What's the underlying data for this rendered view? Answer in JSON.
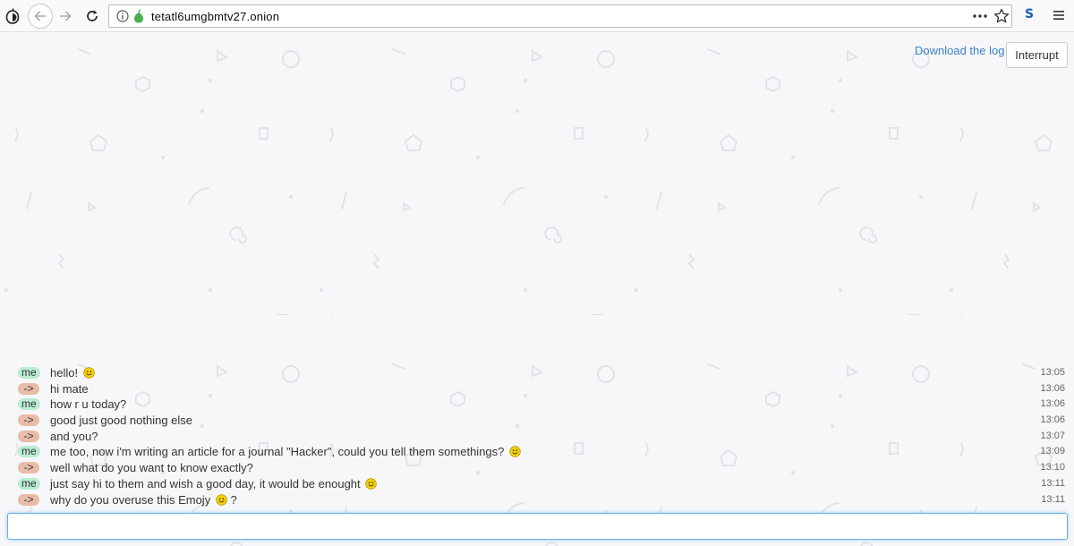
{
  "browser": {
    "url": "tetatl6umgbmtv27.onion",
    "extension_label": "S",
    "icons": [
      "tor-onion-icon",
      "back-icon",
      "forward-icon",
      "reload-icon",
      "info-icon",
      "onion-site-icon",
      "page-actions-icon",
      "bookmark-star-icon",
      "extension-s-icon",
      "hamburger-menu-icon"
    ]
  },
  "header": {
    "download_label": "Download the log",
    "interrupt_label": "Interrupt"
  },
  "messages": [
    {
      "sender": "me",
      "text": "hello!",
      "emoji": true,
      "emoji_suffix": "",
      "time": "13:05"
    },
    {
      "sender": "->",
      "text": "hi mate",
      "emoji": false,
      "emoji_suffix": "",
      "time": "13:06"
    },
    {
      "sender": "me",
      "text": "how r u today?",
      "emoji": false,
      "emoji_suffix": "",
      "time": "13:06"
    },
    {
      "sender": "->",
      "text": "good just good nothing else",
      "emoji": false,
      "emoji_suffix": "",
      "time": "13:06"
    },
    {
      "sender": "->",
      "text": "and you?",
      "emoji": false,
      "emoji_suffix": "",
      "time": "13:07"
    },
    {
      "sender": "me",
      "text": "me too, now i'm writing an article for a journal \"Hacker\", could you tell them somethings?",
      "emoji": true,
      "emoji_suffix": "",
      "time": "13:09"
    },
    {
      "sender": "->",
      "text": "well what do you want to know exactly?",
      "emoji": false,
      "emoji_suffix": "",
      "time": "13:10"
    },
    {
      "sender": "me",
      "text": "just say hi to them and wish a good day, it would be enought",
      "emoji": true,
      "emoji_suffix": "",
      "time": "13:11"
    },
    {
      "sender": "->",
      "text": "why do you overuse this Emojy",
      "emoji": true,
      "emoji_suffix": " ?",
      "time": "13:11"
    }
  ],
  "input": {
    "value": "",
    "placeholder": ""
  },
  "colors": {
    "me_badge": "#b9ecd4",
    "other_badge": "#e8bca7",
    "link": "#3a82c4",
    "input_focus": "#66afe9",
    "emoji": "#f5d000"
  }
}
